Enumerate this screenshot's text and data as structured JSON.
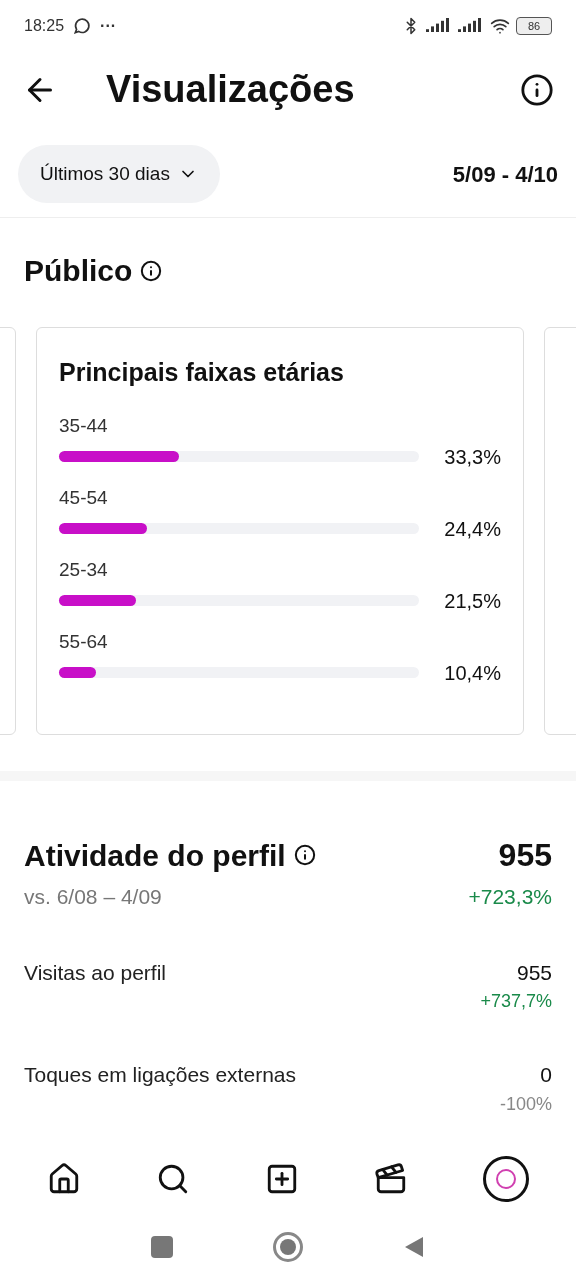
{
  "status_bar": {
    "time": "18:25",
    "dots": "···",
    "battery": "86"
  },
  "header": {
    "title": "Visualizações"
  },
  "filter": {
    "label": "Últimos 30 dias",
    "range": "5/09 - 4/10"
  },
  "audience": {
    "title": "Público",
    "card": {
      "title": "Principais faixas etárias",
      "rows": [
        {
          "label": "35-44",
          "level": 0.333,
          "value": "33,3%"
        },
        {
          "label": "45-54",
          "level": 0.244,
          "value": "24,4%"
        },
        {
          "label": "25-34",
          "level": 0.215,
          "value": "21,5%"
        },
        {
          "label": "55-64",
          "level": 0.104,
          "value": "10,4%"
        }
      ]
    }
  },
  "activity": {
    "title": "Atividade do perfil",
    "total": "955",
    "compare": "vs. 6/08 – 4/09",
    "change": "+723,3%",
    "kind": "up",
    "rows": [
      {
        "label": "Visitas ao perfil",
        "value": "955",
        "change": "+737,7%",
        "kind": "up"
      },
      {
        "label": "Toques em ligações externas",
        "value": "0",
        "change": "-100%",
        "kind": "neutral"
      }
    ]
  }
}
